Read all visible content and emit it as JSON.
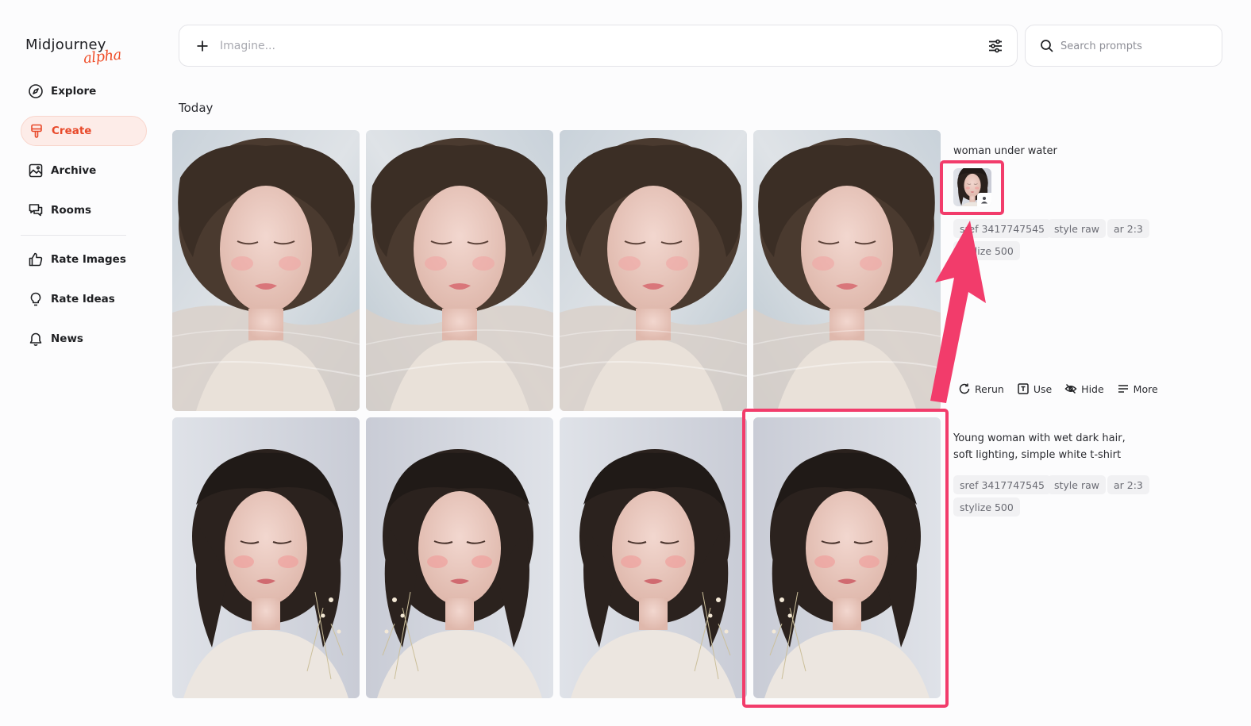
{
  "app": {
    "logo_text": "Midjourney",
    "logo_badge": "alpha"
  },
  "sidebar": {
    "items": [
      {
        "label": "Explore",
        "icon": "compass-icon",
        "active": false
      },
      {
        "label": "Create",
        "icon": "paintbrush-icon",
        "active": true
      },
      {
        "label": "Archive",
        "icon": "image-icon",
        "active": false
      },
      {
        "label": "Rooms",
        "icon": "chat-bubbles-icon",
        "active": false
      },
      {
        "label": "Rate Images",
        "icon": "thumbs-up-icon",
        "active": false
      },
      {
        "label": "Rate Ideas",
        "icon": "lightbulb-icon",
        "active": false
      },
      {
        "label": "News",
        "icon": "bell-icon",
        "active": false
      }
    ]
  },
  "imagine": {
    "placeholder": "Imagine..."
  },
  "search": {
    "placeholder": "Search prompts"
  },
  "section": {
    "title": "Today"
  },
  "jobs": [
    {
      "prompt": "woman under water",
      "tags": [
        "sref 3417747545",
        "style raw",
        "ar 2:3",
        "stylize 500"
      ],
      "actions": [
        {
          "label": "Rerun",
          "icon": "rerun-icon"
        },
        {
          "label": "Use",
          "icon": "text-box-icon"
        },
        {
          "label": "Hide",
          "icon": "eye-off-icon"
        },
        {
          "label": "More",
          "icon": "menu-lines-icon"
        }
      ]
    },
    {
      "prompt_line1": "Young woman with wet dark hair,",
      "prompt_line2": "soft lighting, simple white t-shirt",
      "tags": [
        "sref 3417747545",
        "style raw",
        "ar 2:3",
        "stylize 500"
      ]
    }
  ],
  "colors": {
    "accent": "#e8492a",
    "highlight": "#f23c6b"
  }
}
